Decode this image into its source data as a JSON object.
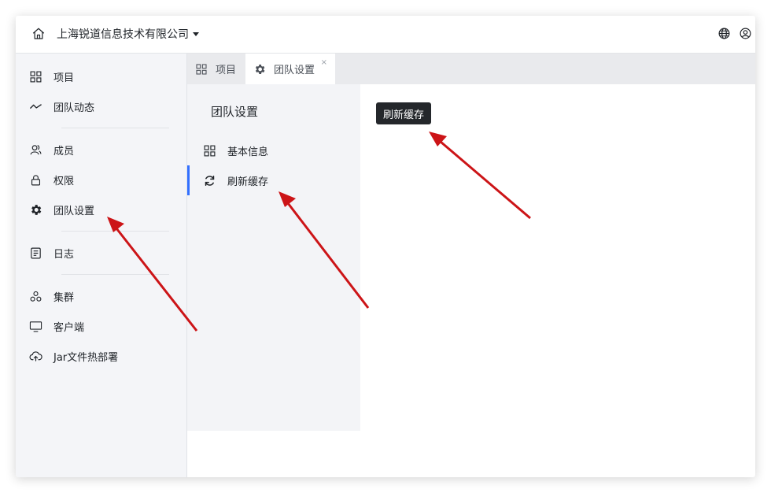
{
  "header": {
    "company": "上海锐道信息技术有限公司",
    "icons": [
      "home-icon",
      "globe-icon",
      "user-icon"
    ]
  },
  "sidebar": {
    "groups": [
      [
        {
          "label": "项目",
          "icon": "grid-icon"
        },
        {
          "label": "团队动态",
          "icon": "trend-icon"
        }
      ],
      [
        {
          "label": "成员",
          "icon": "users-icon"
        },
        {
          "label": "权限",
          "icon": "lock-icon"
        },
        {
          "label": "团队设置",
          "icon": "gear-icon"
        }
      ],
      [
        {
          "label": "日志",
          "icon": "log-icon"
        }
      ],
      [
        {
          "label": "集群",
          "icon": "cluster-icon"
        },
        {
          "label": "客户端",
          "icon": "monitor-icon"
        },
        {
          "label": "Jar文件热部署",
          "icon": "cloud-upload-icon"
        }
      ]
    ]
  },
  "tabs": [
    {
      "label": "项目",
      "icon": "grid-icon",
      "active": false
    },
    {
      "label": "团队设置",
      "icon": "gear-icon",
      "active": true,
      "close": "×"
    }
  ],
  "submenu": {
    "title": "团队设置",
    "items": [
      {
        "label": "基本信息",
        "icon": "grid-icon",
        "active": false
      },
      {
        "label": "刷新缓存",
        "icon": "refresh-icon",
        "active": true
      }
    ]
  },
  "content": {
    "button_label": "刷新缓存"
  },
  "colors": {
    "accent": "#3370ff",
    "arrow": "#cc1417",
    "button_bg": "#24272b"
  }
}
